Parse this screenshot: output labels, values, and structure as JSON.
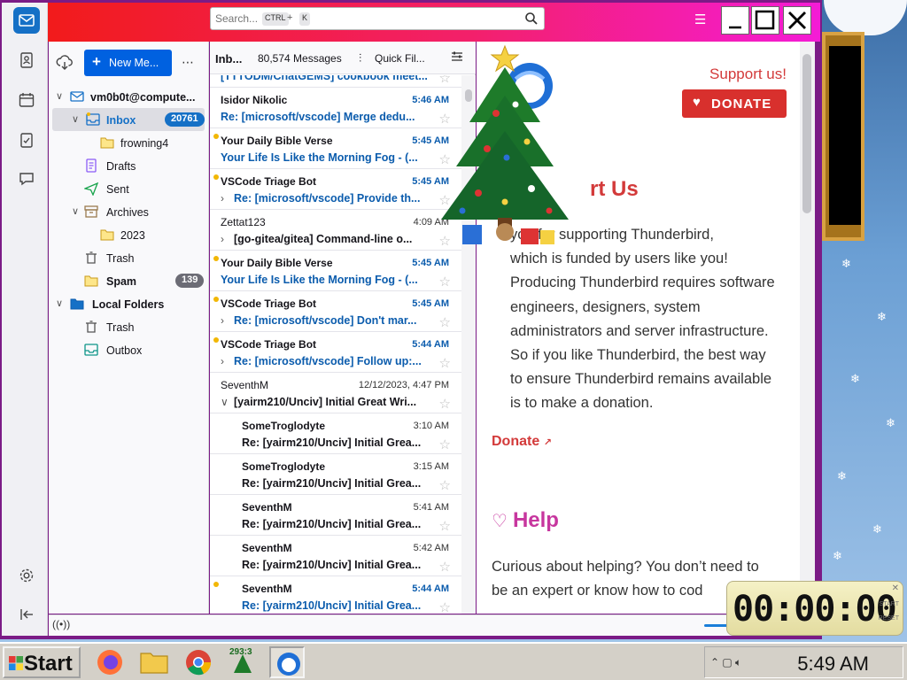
{
  "search": {
    "placeholder": "Search...",
    "shortcut_key1": "CTRL",
    "shortcut_plus": "+",
    "shortcut_key2": "K"
  },
  "toolbar": {
    "new_message": "New Me..."
  },
  "accounts": {
    "account_name": "vm0b0t@compute...",
    "folders": [
      {
        "label": "Inbox",
        "badge": "20761"
      },
      {
        "label": "frowning4"
      },
      {
        "label": "Drafts"
      },
      {
        "label": "Sent"
      },
      {
        "label": "Archives"
      },
      {
        "label": "2023"
      },
      {
        "label": "Trash"
      },
      {
        "label": "Spam",
        "badge": "139"
      }
    ],
    "local_folders": {
      "label": "Local Folders",
      "items": [
        {
          "label": "Trash"
        },
        {
          "label": "Outbox"
        }
      ]
    }
  },
  "list_header": {
    "folder": "Inb...",
    "count": "80,574 Messages",
    "quick_filter": "Quick Fil..."
  },
  "messages": [
    {
      "sender": "",
      "time": "",
      "subject": "[TTTODM/ChatGEMS] cookbook meet..."
    },
    {
      "sender": "Isidor Nikolic",
      "time": "5:46 AM",
      "subject": "Re: [microsoft/vscode] Merge dedu..."
    },
    {
      "sender": "Your Daily Bible Verse",
      "time": "5:45 AM",
      "subject": "Your Life Is Like the Morning Fog - (..."
    },
    {
      "sender": "VSCode Triage Bot",
      "time": "5:45 AM",
      "subject": "Re: [microsoft/vscode] Provide th..."
    },
    {
      "sender": "Zettat123",
      "time": "4:09 AM",
      "subject": "[go-gitea/gitea] Command-line o..."
    },
    {
      "sender": "Your Daily Bible Verse",
      "time": "5:45 AM",
      "subject": "Your Life Is Like the Morning Fog - (..."
    },
    {
      "sender": "VSCode Triage Bot",
      "time": "5:45 AM",
      "subject": "Re: [microsoft/vscode] Don't mar..."
    },
    {
      "sender": "VSCode Triage Bot",
      "time": "5:44 AM",
      "subject": "Re: [microsoft/vscode] Follow up:..."
    },
    {
      "sender": "SeventhM",
      "time": "12/12/2023, 4:47 PM",
      "subject": "[yairm210/Unciv] Initial Great Wri..."
    },
    {
      "sender": "SomeTroglodyte",
      "time": "3:10 AM",
      "subject": "Re: [yairm210/Unciv] Initial Grea..."
    },
    {
      "sender": "SomeTroglodyte",
      "time": "3:15 AM",
      "subject": "Re: [yairm210/Unciv] Initial Grea..."
    },
    {
      "sender": "SeventhM",
      "time": "5:41 AM",
      "subject": "Re: [yairm210/Unciv] Initial Grea..."
    },
    {
      "sender": "SeventhM",
      "time": "5:42 AM",
      "subject": "Re: [yairm210/Unciv] Initial Grea..."
    },
    {
      "sender": "SeventhM",
      "time": "5:44 AM",
      "subject": "Re: [yairm210/Unciv] Initial Grea..."
    }
  ],
  "reading": {
    "support_link": "Support us!",
    "donate_button": "DONATE",
    "section_title": "rt Us",
    "paragraph1": "you for supporting Thunderbird,\nwhich is funded by users like you!\nProducing Thunderbird requires software\nengineers, designers, system\nadministrators and server infrastructure.\nSo if you like Thunderbird, the best way\nto ensure Thunderbird remains available\nis to make a donation.",
    "donate_link": "Donate",
    "help_title": "Help",
    "paragraph2": "Curious about helping? You don’t need to\nbe an expert or know how to cod"
  },
  "timer": {
    "display": "00:00:00",
    "start": "START",
    "reset": "RESET"
  },
  "taskbar": {
    "start": "Start",
    "tree_badge": "293:3",
    "clock": "5:49 AM"
  },
  "colors": {
    "accent": "#0061e0",
    "title_gradient_start": "#f21b1b",
    "title_gradient_end": "#f41cd6",
    "unread_link": "#0b5cad",
    "donate_red": "#d8302d",
    "help_pink": "#c7369e"
  }
}
